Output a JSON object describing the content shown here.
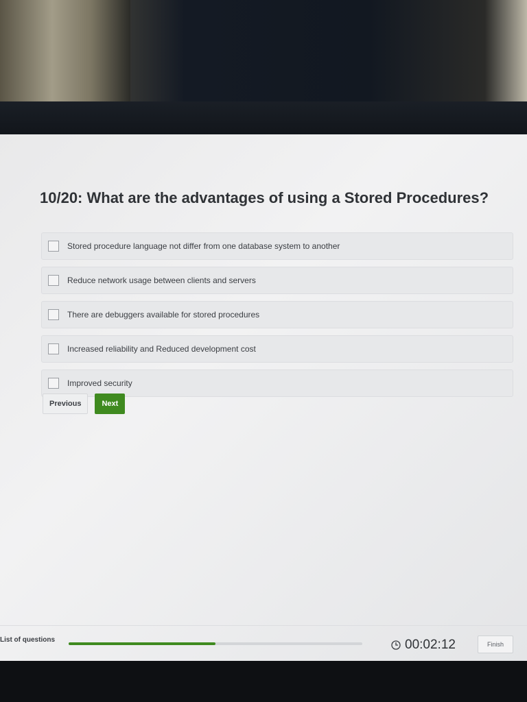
{
  "question": {
    "title": "10/20: What are the advantages of using a Stored Procedures?"
  },
  "options": [
    {
      "label": "Stored procedure language not differ from one database system to another",
      "checked": false
    },
    {
      "label": "Reduce network usage between clients and servers",
      "checked": false
    },
    {
      "label": "There are debuggers available for stored procedures",
      "checked": false
    },
    {
      "label": "Increased reliability and Reduced development cost",
      "checked": false
    },
    {
      "label": "Improved security",
      "checked": false
    }
  ],
  "navigation": {
    "previous_label": "Previous",
    "next_label": "Next"
  },
  "footer": {
    "list_label": "List of questions",
    "progress": 0.5,
    "timer": "00:02:12",
    "finish_label": "Finish"
  },
  "colors": {
    "accent": "#3f8a1f",
    "text": "#2f3236"
  },
  "icons": {
    "timer": "clock-icon"
  }
}
